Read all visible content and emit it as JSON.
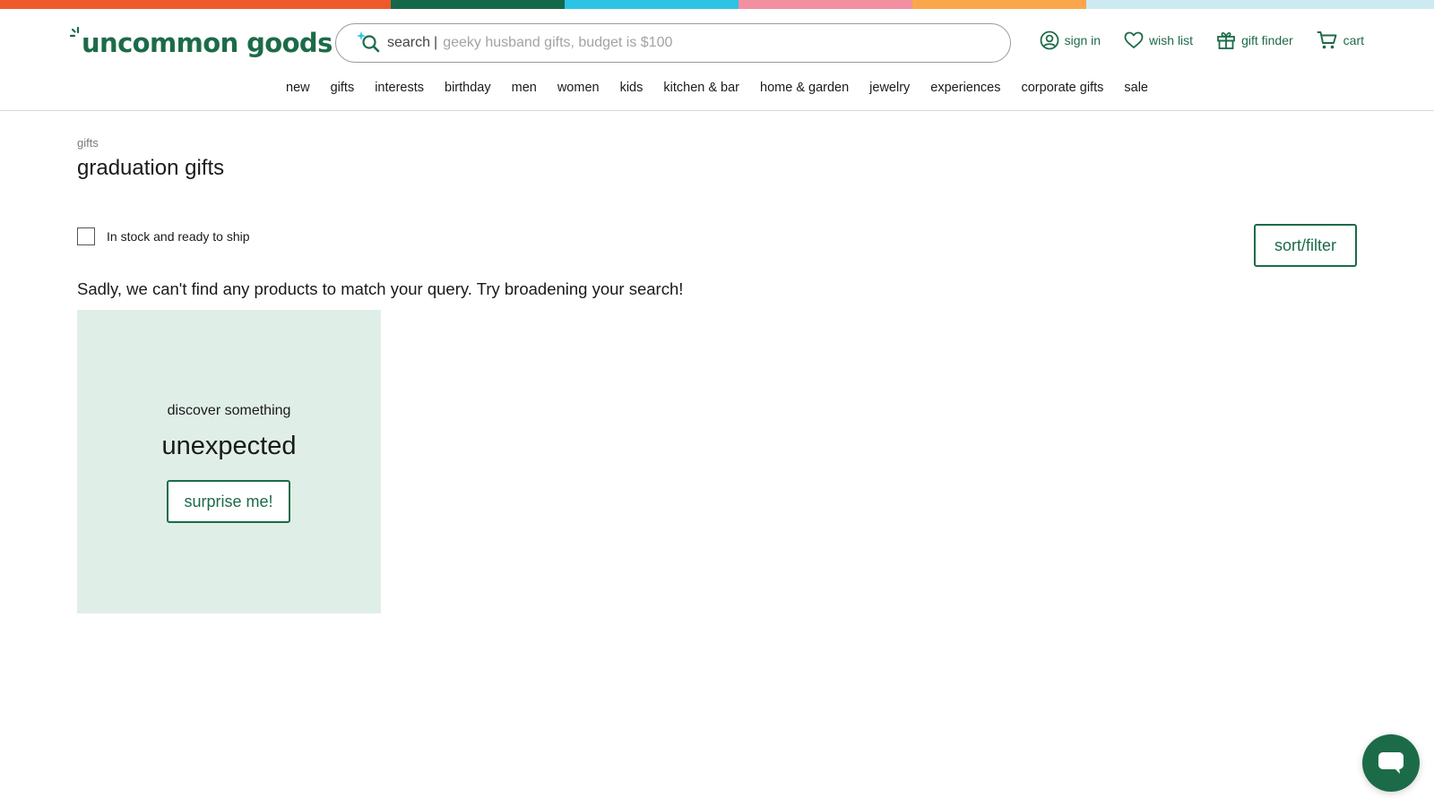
{
  "colors": {
    "brand_green": "#1c6b48",
    "stripe": [
      "#ee5a2a",
      "#14684a",
      "#2cc3e5",
      "#f28fa0",
      "#fca64b",
      "#cdeaf2"
    ],
    "promo_background": "#e0eee8"
  },
  "header": {
    "logo_text": "uncommon goods",
    "search": {
      "label": "search",
      "cursor": "|",
      "placeholder": "geeky husband gifts, budget is $100",
      "value": "",
      "icon": "sparkle-search-icon"
    },
    "util_nav": [
      {
        "label": "sign in",
        "icon": "user-circle-icon"
      },
      {
        "label": "wish list",
        "icon": "heart-icon"
      },
      {
        "label": "gift finder",
        "icon": "gift-icon"
      },
      {
        "label": "cart",
        "icon": "cart-icon"
      }
    ],
    "main_nav": [
      "new",
      "gifts",
      "interests",
      "birthday",
      "men",
      "women",
      "kids",
      "kitchen & bar",
      "home & garden",
      "jewelry",
      "experiences",
      "corporate gifts",
      "sale"
    ]
  },
  "page": {
    "breadcrumb": "gifts",
    "title": "graduation gifts",
    "stock_filter_label": "In stock and ready to ship",
    "stock_filter_checked": false,
    "sort_filter_label": "sort/filter",
    "empty_message": "Sadly, we can't find any products to match your query. Try broadening your search!"
  },
  "promo": {
    "kicker": "discover something",
    "headline": "unexpected",
    "button_label": "surprise me!"
  },
  "chat": {
    "icon": "chat-bubble-icon"
  }
}
